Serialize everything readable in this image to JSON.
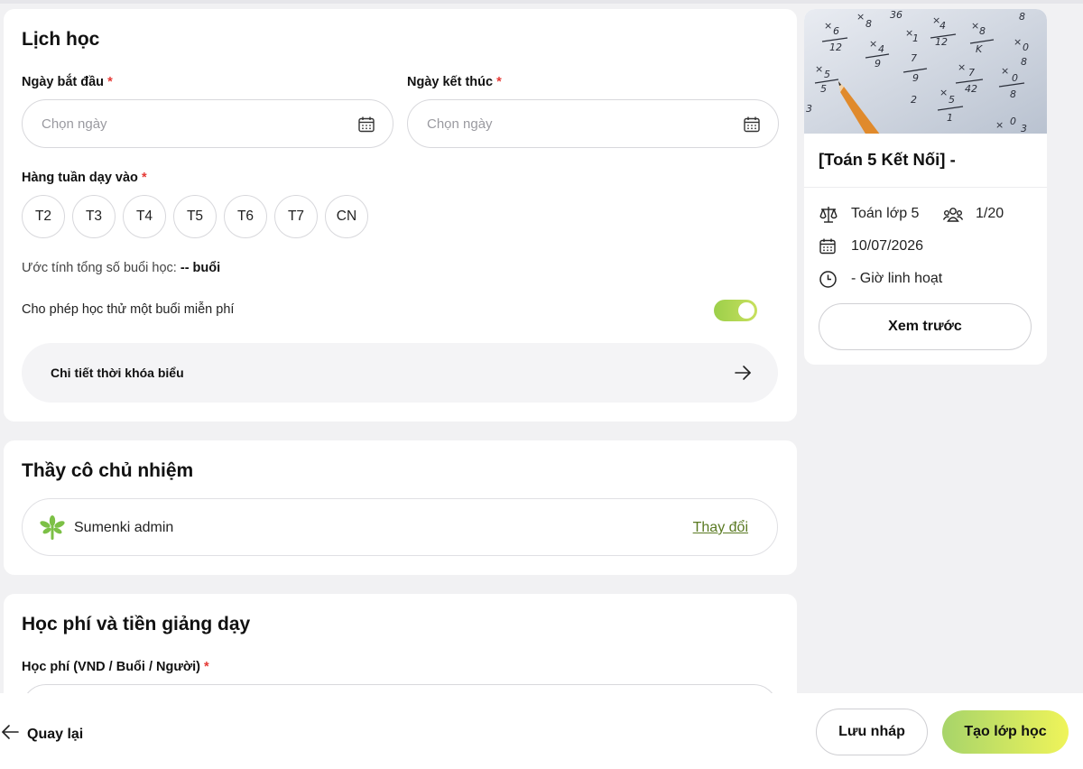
{
  "schedule": {
    "title": "Lịch học",
    "start_label": "Ngày bắt đầu",
    "end_label": "Ngày kết thúc",
    "required_mark": "*",
    "start_placeholder": "Chọn ngày",
    "end_placeholder": "Chọn ngày",
    "weekly_label": "Hàng tuần dạy vào",
    "days": [
      "T2",
      "T3",
      "T4",
      "T5",
      "T6",
      "T7",
      "CN"
    ],
    "estimate_prefix": "Ước tính tổng số buổi học:",
    "estimate_value": "-- buổi",
    "trial_label": "Cho phép học thử một buổi miễn phí",
    "trial_enabled": true,
    "detail_label": "Chi tiết thời khóa biểu"
  },
  "teacher": {
    "title": "Thầy cô chủ nhiệm",
    "name": "Sumenki admin",
    "change_label": "Thay đổi"
  },
  "fee": {
    "title": "Học phí và tiền giảng dạy",
    "fee_label": "Học phí (VND / Buổi / Người)"
  },
  "side": {
    "course_title": "[Toán 5 Kết Nối] -",
    "subject": "Toán lớp 5",
    "capacity": "1/20",
    "date": "10/07/2026",
    "time": "- Giờ linh hoạt",
    "preview_label": "Xem trước"
  },
  "footer": {
    "back_label": "Quay lại",
    "draft_label": "Lưu nháp",
    "create_label": "Tạo lớp học"
  },
  "colors": {
    "accent_green": "#9ccf4a",
    "link_green": "#5a7a22",
    "required_red": "#e53935"
  }
}
